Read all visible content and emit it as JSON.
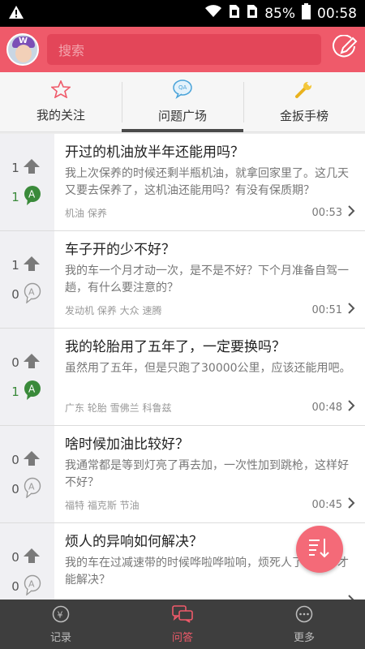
{
  "status_bar": {
    "battery": "85%",
    "time": "00:58"
  },
  "header": {
    "search_placeholder": "搜索"
  },
  "tabs": [
    {
      "label": "我的关注"
    },
    {
      "label": "问题广场"
    },
    {
      "label": "金扳手榜"
    }
  ],
  "questions": [
    {
      "up": "1",
      "answers": "1",
      "answered": true,
      "title": "开过的机油放半年还能用吗？",
      "body": "我上次保养的时候还剩半瓶机油，就拿回家里了。这几天又要去保养了，这机油还能用吗？有没有保质期？",
      "tags": "机油  保养",
      "time": "00:53"
    },
    {
      "up": "1",
      "answers": "0",
      "answered": false,
      "title": "车子开的少不好？",
      "body": "我的车一个月才动一次，是不是不好？下个月准备自驾一趟，有什么要注意的？",
      "tags": "发动机  保养  大众 速腾",
      "time": "00:51"
    },
    {
      "up": "0",
      "answers": "1",
      "answered": true,
      "title": "我的轮胎用了五年了，一定要换吗？",
      "body": "虽然用了五年，但是只跑了30000公里，应该还能用吧。",
      "tags": "广东  轮胎  雪佛兰 科鲁兹",
      "time": "00:48"
    },
    {
      "up": "0",
      "answers": "0",
      "answered": false,
      "title": "啥时候加油比较好？",
      "body": "我通常都是等到灯亮了再去加，一次性加到跳枪，这样好不好？",
      "tags": "福特 福克斯  节油",
      "time": "00:45"
    },
    {
      "up": "0",
      "answers": "0",
      "answered": false,
      "title": "烦人的异响如何解决？",
      "body": "我的车在过减速带的时候哗啦哗啦响，烦死人了，怎样才能解决？",
      "tags": "",
      "time": ""
    }
  ],
  "bottom_nav": [
    {
      "label": "记录"
    },
    {
      "label": "问答"
    },
    {
      "label": "更多"
    }
  ],
  "colors": {
    "brand": "#ef5a6a",
    "answered_green": "#3a8a3a"
  }
}
